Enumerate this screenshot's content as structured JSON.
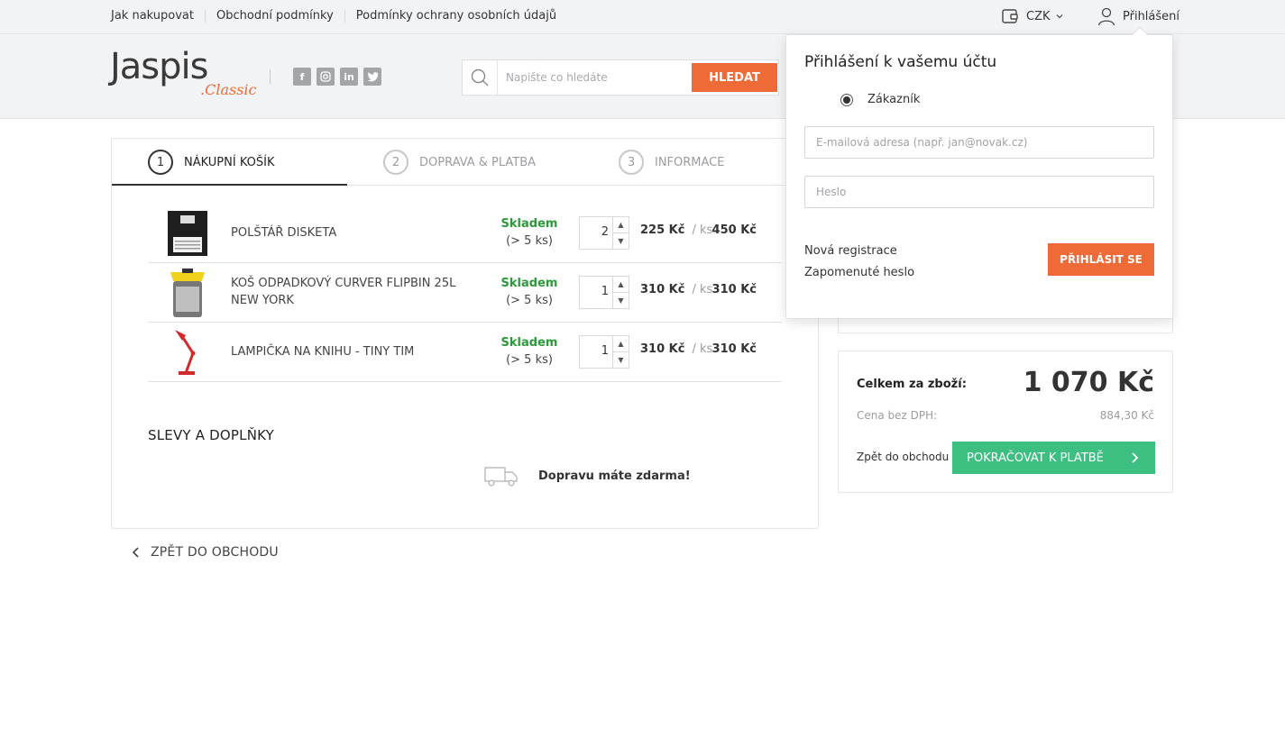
{
  "topbar": {
    "links": [
      "Jak nakupovat",
      "Obchodní podmínky",
      "Podmínky ochrany osobních údajů"
    ],
    "currency": "CZK",
    "login_label": "Přihlášení"
  },
  "header": {
    "logo_main": "Jaspis",
    "logo_sub": ".Classic",
    "socials": [
      "f",
      "ig",
      "in",
      "tw"
    ],
    "search_placeholder": "Napište co hledáte",
    "search_button": "HLEDAT"
  },
  "steps": [
    {
      "num": "1",
      "label": "NÁKUPNÍ KOŠÍK"
    },
    {
      "num": "2",
      "label": "DOPRAVA & PLATBA"
    },
    {
      "num": "3",
      "label": "INFORMACE"
    }
  ],
  "cart": {
    "items": [
      {
        "name": "POLŠTÁŘ DISKETA",
        "stock": "Skladem",
        "stock_note": "(> 5 ks)",
        "qty": "2",
        "unit_price": "225 Kč",
        "per": "/ ks",
        "total": "450 Kč"
      },
      {
        "name": "KOŠ ODPADKOVÝ CURVER FLIPBIN 25L NEW YORK",
        "stock": "Skladem",
        "stock_note": "(> 5 ks)",
        "qty": "1",
        "unit_price": "310 Kč",
        "per": "/ ks",
        "total": "310 Kč"
      },
      {
        "name": "LAMPIČKA NA KNIHU - TINY TIM",
        "stock": "Skladem",
        "stock_note": "(> 5 ks)",
        "qty": "1",
        "unit_price": "310 Kč",
        "per": "/ ks",
        "total": "310 Kč"
      }
    ],
    "discounts_title": "SLEVY A DOPLŇKY",
    "shipping_text": "Dopravu máte zdarma!",
    "back_label": "ZPĚT DO OBCHODU"
  },
  "summary": {
    "total_label": "Celkem za zboží:",
    "total_value": "1 070 Kč",
    "net_label": "Cena bez DPH:",
    "net_value": "884,30 Kč",
    "back_label": "Zpět do obchodu",
    "pay_button": "POKRAČOVAT K PLATBĚ"
  },
  "login_popup": {
    "title": "Přihlášení k vašemu účtu",
    "radio_label": "Zákazník",
    "email_placeholder": "E-mailová adresa (např. jan@novak.cz)",
    "password_placeholder": "Heslo",
    "register_link": "Nová registrace",
    "forgot_link": "Zapomenuté heslo",
    "login_button": "PŘIHLÁSIT SE"
  },
  "colors": {
    "accent_orange": "#ee6a36",
    "accent_green": "#3ebf82",
    "stock_green": "#2b9b3a"
  }
}
